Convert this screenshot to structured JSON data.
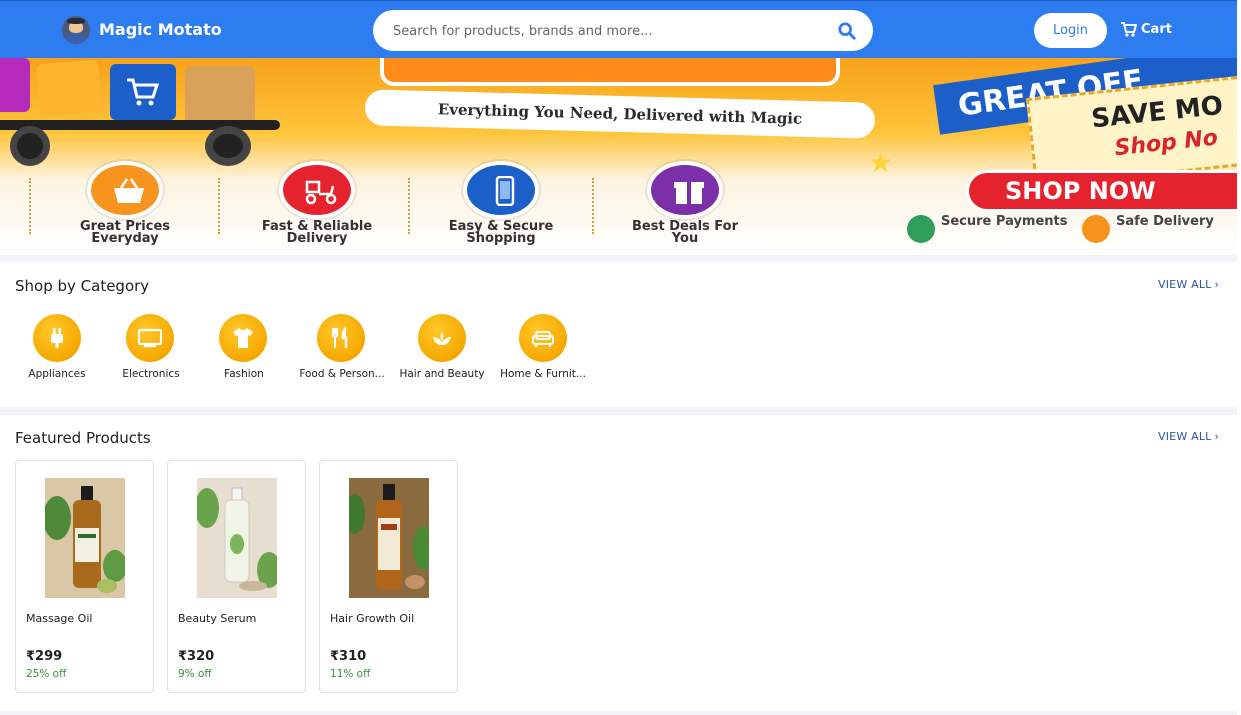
{
  "header": {
    "brand": "Magic Motato",
    "search_placeholder": "Search for products, brands and more...",
    "login_label": "Login",
    "cart_label": "Cart",
    "colors": {
      "bar": "#2d7cf0"
    }
  },
  "banner": {
    "tagline": "Everything You Need, Delivered with Magic",
    "headline": "GREAT OFF",
    "save_line": "SAVE MO",
    "shop_line": "Shop No",
    "cta": "SHOP NOW",
    "features": [
      {
        "label": "Great Prices Everyday",
        "icon": "basket-icon",
        "color": "#f7941d"
      },
      {
        "label": "Fast & Reliable Delivery",
        "icon": "scooter-icon",
        "color": "#e5232e"
      },
      {
        "label": "Easy & Secure Shopping",
        "icon": "phone-icon",
        "color": "#1d5fc8"
      },
      {
        "label": "Best Deals For You",
        "icon": "gift-icon",
        "color": "#7b2fa8"
      }
    ],
    "badges": [
      {
        "label": "Secure Payments",
        "icon": "shield-icon"
      },
      {
        "label": "Safe Delivery",
        "icon": "truck-icon"
      }
    ]
  },
  "categories": {
    "title": "Shop by Category",
    "view_all": "VIEW ALL",
    "items": [
      {
        "label": "Appliances",
        "icon": "plug-icon"
      },
      {
        "label": "Electronics",
        "icon": "monitor-icon"
      },
      {
        "label": "Fashion",
        "icon": "tshirt-icon"
      },
      {
        "label": "Food & Person...",
        "icon": "fork-knife-icon"
      },
      {
        "label": "Hair and Beauty",
        "icon": "lotus-icon"
      },
      {
        "label": "Home & Furnit...",
        "icon": "sofa-icon"
      }
    ]
  },
  "featured": {
    "title": "Featured Products",
    "view_all": "VIEW ALL",
    "products": [
      {
        "name": "Massage Oil",
        "price": "₹299",
        "discount": "25% off"
      },
      {
        "name": "Beauty Serum",
        "price": "₹320",
        "discount": "9% off"
      },
      {
        "name": "Hair Growth Oil",
        "price": "₹310",
        "discount": "11% off"
      }
    ]
  },
  "accent_color": "#f6a800"
}
